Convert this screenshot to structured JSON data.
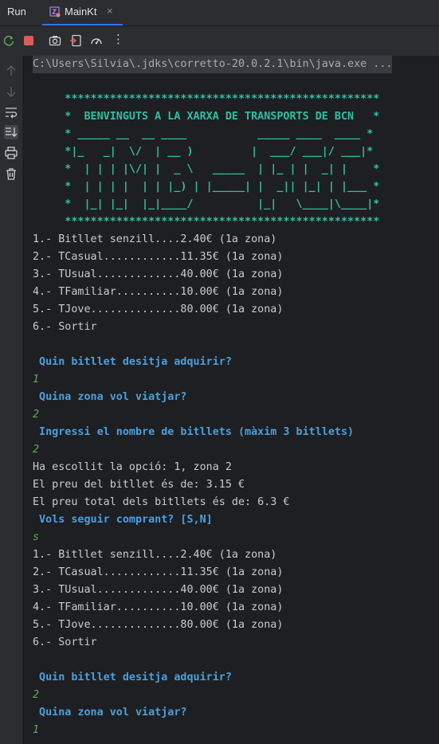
{
  "topbar": {
    "run_label": "Run",
    "tab_label": "MainKt",
    "tab_close": "×"
  },
  "toolbar": {
    "buttons": [
      "rerun-icon",
      "stop-icon",
      "camera-icon",
      "exit-icon",
      "profiler-icon",
      "more-icon"
    ],
    "more_glyph": "⋮"
  },
  "sidebar": {
    "buttons": [
      "arrow-up-icon",
      "arrow-down-icon",
      "soft-wrap-icon",
      "scroll-to-end-icon",
      "print-icon",
      "trash-icon"
    ]
  },
  "colors": {
    "banner": "#2fbfa5",
    "prompt": "#4a9fe0",
    "input": "#5ca85c",
    "accent": "#3574f0"
  },
  "console": {
    "lines": [
      {
        "t": "C:\\Users\\Silvia\\.jdks\\corretto-20.0.2.1\\bin\\java.exe ...",
        "k": "cmd"
      },
      {
        "t": "",
        "k": "out"
      },
      {
        "t": "     *************************************************",
        "k": "banner"
      },
      {
        "t": "     *  BENVINGUTS A LA XARXA DE TRANSPORTS DE BCN   *",
        "k": "banner"
      },
      {
        "t": "     * _____ __  __ ____           _____ ____  ____ *",
        "k": "banner"
      },
      {
        "t": "     *|_   _|  \\/  | __ )         |  ___/ ___|/ ___|*",
        "k": "banner"
      },
      {
        "t": "     *  | | | |\\/| |  _ \\   _____  | |_ | |  _| |    *",
        "k": "banner"
      },
      {
        "t": "     *  | | | |  | | |_) | |_____| |  _|| |_| | |___ *",
        "k": "banner"
      },
      {
        "t": "     *  |_| |_|  |_|____/          |_|   \\____|\\____|*",
        "k": "banner"
      },
      {
        "t": "     *************************************************",
        "k": "banner"
      },
      {
        "t": "1.- Bitllet senzill....2.40€ (1a zona)",
        "k": "out"
      },
      {
        "t": "2.- TCasual............11.35€ (1a zona)",
        "k": "out"
      },
      {
        "t": "3.- TUsual.............40.00€ (1a zona)",
        "k": "out"
      },
      {
        "t": "4.- TFamiliar..........10.00€ (1a zona)",
        "k": "out"
      },
      {
        "t": "5.- TJove..............80.00€ (1a zona)",
        "k": "out"
      },
      {
        "t": "6.- Sortir",
        "k": "out"
      },
      {
        "t": "",
        "k": "out"
      },
      {
        "t": " Quin bitllet desitja adquirir?",
        "k": "prompt"
      },
      {
        "t": "1",
        "k": "input"
      },
      {
        "t": " Quina zona vol viatjar?",
        "k": "prompt"
      },
      {
        "t": "2",
        "k": "input"
      },
      {
        "t": " Ingressi el nombre de bitllets (màxim 3 bitllets)",
        "k": "prompt"
      },
      {
        "t": "2",
        "k": "input"
      },
      {
        "t": "Ha escollit la opció: 1, zona 2",
        "k": "out"
      },
      {
        "t": "El preu del bitllet és de: 3.15 €",
        "k": "out"
      },
      {
        "t": "El preu total dels bitllets és de: 6.3 €",
        "k": "out"
      },
      {
        "t": " Vols seguir comprant? [S,N]",
        "k": "prompt"
      },
      {
        "t": "s",
        "k": "input"
      },
      {
        "t": "1.- Bitllet senzill....2.40€ (1a zona)",
        "k": "out"
      },
      {
        "t": "2.- TCasual............11.35€ (1a zona)",
        "k": "out"
      },
      {
        "t": "3.- TUsual.............40.00€ (1a zona)",
        "k": "out"
      },
      {
        "t": "4.- TFamiliar..........10.00€ (1a zona)",
        "k": "out"
      },
      {
        "t": "5.- TJove..............80.00€ (1a zona)",
        "k": "out"
      },
      {
        "t": "6.- Sortir",
        "k": "out"
      },
      {
        "t": "",
        "k": "out"
      },
      {
        "t": " Quin bitllet desitja adquirir?",
        "k": "prompt"
      },
      {
        "t": "2",
        "k": "input"
      },
      {
        "t": " Quina zona vol viatjar?",
        "k": "prompt"
      },
      {
        "t": "1",
        "k": "input"
      }
    ]
  }
}
